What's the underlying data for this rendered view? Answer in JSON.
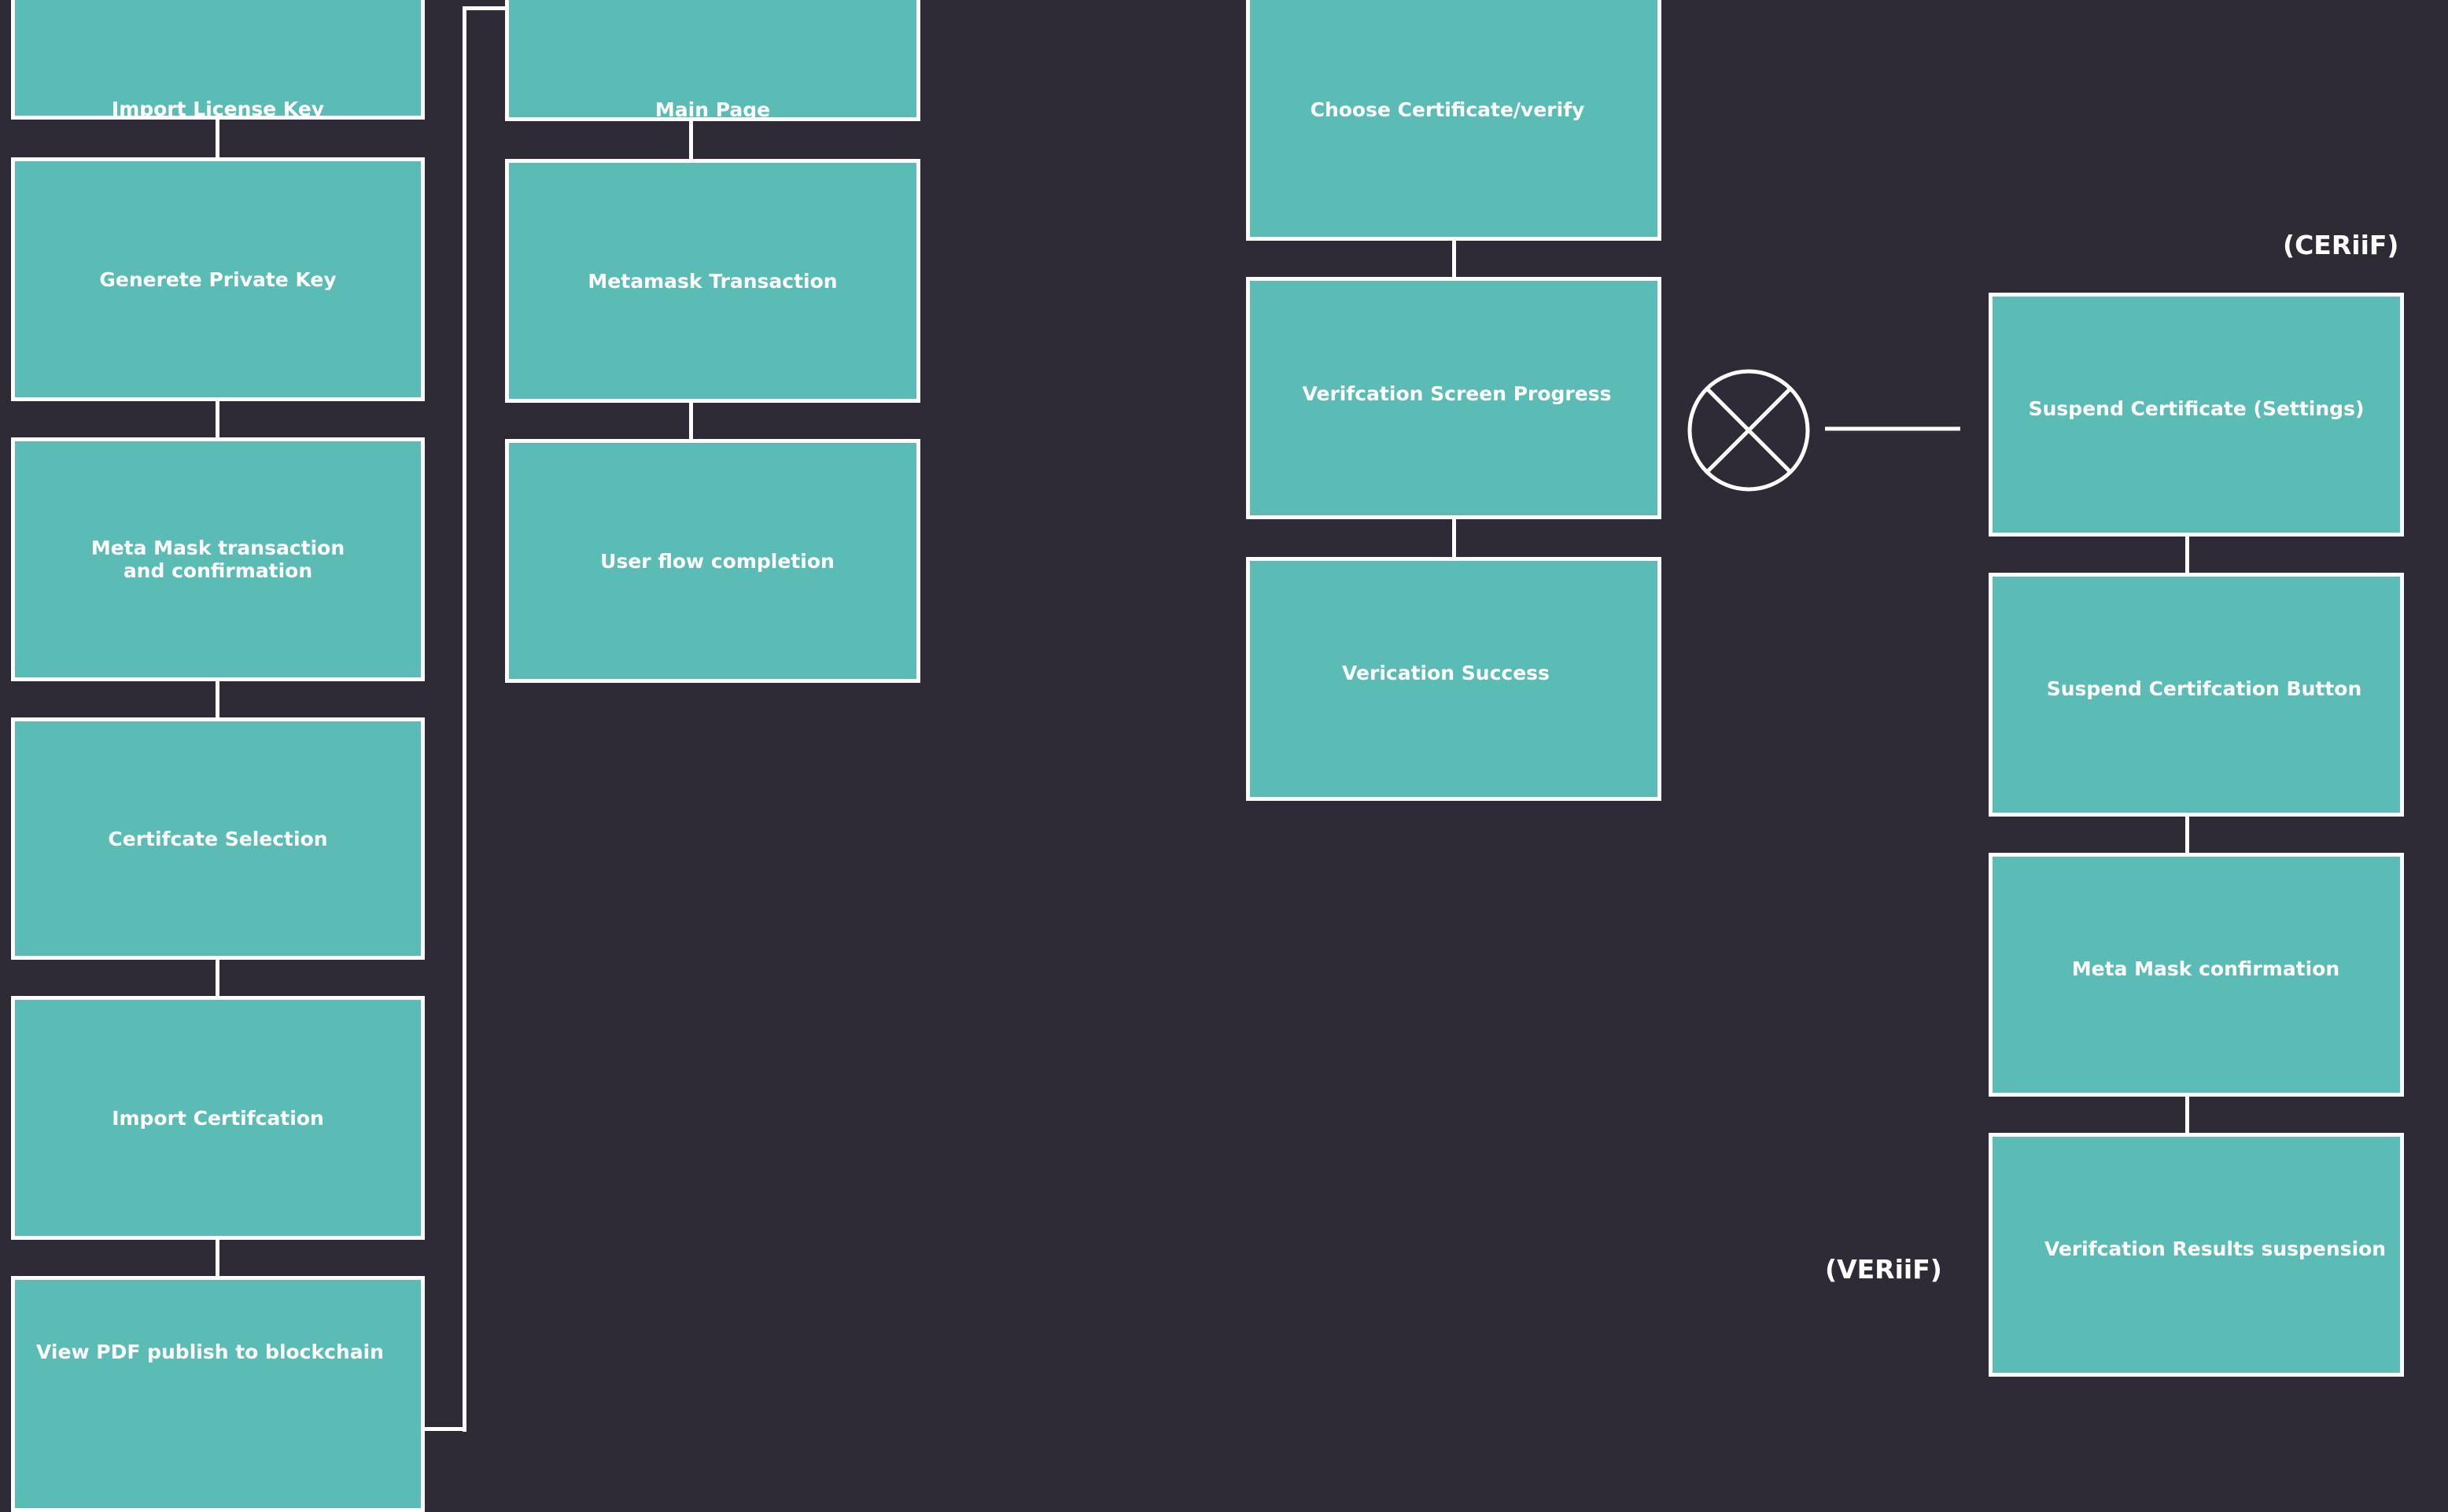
{
  "nodes": {
    "import_license_key": "Import License Key",
    "generate_private_key": "Generete Private Key",
    "metamask_tx_confirm": "Meta Mask transaction\nand confirmation",
    "certificate_selection": "Certifcate Selection",
    "import_certification": "Import Certifcation",
    "view_pdf_publish": "View PDF publish to blockchain",
    "main_page": "Main Page",
    "metamask_transaction": "Metamask Transaction",
    "user_flow_completion": "User flow completion",
    "choose_certificate_verify": "Choose Certificate/verify",
    "verification_screen_progress": "Verifcation Screen Progress",
    "verification_success": "Verication Success",
    "suspend_certificate_settings": "Suspend Certificate (Settings)",
    "suspend_certification_button": "Suspend Certifcation Button",
    "metamask_confirmation": "Meta Mask confirmation",
    "verification_results_suspension": "Verifcation Results suspension"
  },
  "tags": {
    "ceriif": "(CERiiF)",
    "veriif": "(VERiiF)"
  },
  "colors": {
    "background": "#2e2b37",
    "node_fill": "#5bbcb6",
    "stroke": "#ffffff"
  },
  "icons": {
    "junction": "circled-x-icon"
  }
}
